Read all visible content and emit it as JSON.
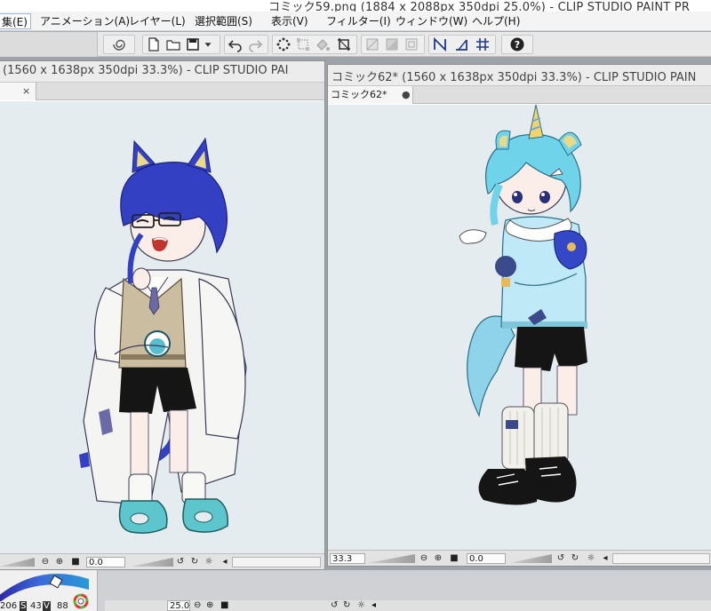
{
  "app_title": "コミック59.png (1884 x 2088px 350dpi 25.0%) - CLIP STUDIO PAINT PR",
  "menu": [
    {
      "label": "集(E)",
      "active": true
    },
    {
      "label": "アニメーション(A)"
    },
    {
      "label": "レイヤー(L)"
    },
    {
      "label": "選択範囲(S)"
    },
    {
      "label": "表示(V)"
    },
    {
      "label": "フィルター(I)"
    },
    {
      "label": "ウィンドウ(W)"
    },
    {
      "label": "ヘルプ(H)"
    }
  ],
  "toolbar": {
    "icons": [
      "swirl-icon",
      "new-file-icon",
      "open-folder-icon",
      "save-icon",
      "undo-icon",
      "redo-icon",
      "select-dots-icon",
      "transform-icon",
      "fill-icon",
      "crop-icon",
      "ruler-off-icon",
      "ruler-fill-icon",
      "grid-cell-icon",
      "perspective-icon",
      "angle-ruler-icon",
      "grid-icon",
      "help-icon"
    ]
  },
  "left_window": {
    "title": "(1560 x 1638px 350dpi 33.3%)  - CLIP STUDIO PAI",
    "tab_close": "×",
    "status": {
      "value": "0.0"
    }
  },
  "right_window": {
    "title": "コミック62* (1560 x 1638px 350dpi 33.3%)  - CLIP STUDIO PAIN",
    "tab_label": "コミック62*",
    "tab_close": "●",
    "status": {
      "zoom": "33.3",
      "value": "0.0"
    }
  },
  "bottom": {
    "color_values": [
      "206",
      "43",
      "88"
    ],
    "color_marks": [
      "S",
      "V"
    ],
    "zoom": "25.0"
  },
  "colors": {
    "canvas_bg": "#e4ecef",
    "hair_blue": "#3340c4",
    "hair_cyan": "#6fd3ea",
    "coat_white": "#f4f4f2",
    "vest_tan": "#cbbd9f",
    "shoe_teal": "#5cc6cc",
    "shorts_black": "#151515",
    "jacket_cyan": "#bfe9f6"
  }
}
